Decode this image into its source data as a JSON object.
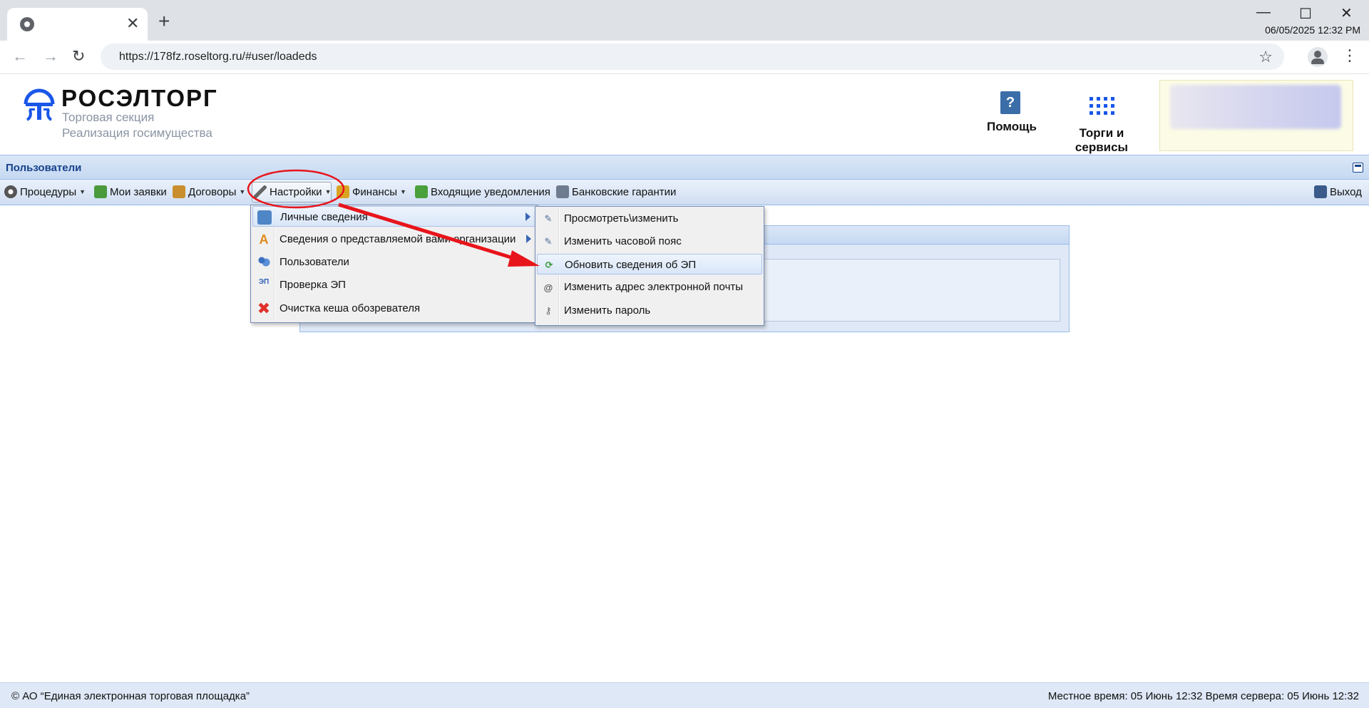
{
  "browser": {
    "url": "https://178fz.roseltorg.ru/#user/loadeds",
    "datetime": "06/05/2025 12:32 PM"
  },
  "header": {
    "logo_title": "РОСЭЛТОРГ",
    "logo_sub1": "Торговая секция",
    "logo_sub2": "Реализация госимущества",
    "help_label": "Помощь",
    "help_glyph": "?",
    "services_label": "Торги и сервисы"
  },
  "panel": {
    "title": "Пользователи"
  },
  "menubar": {
    "procedures": "Процедуры",
    "my_bids": "Мои заявки",
    "contracts": "Договоры",
    "settings": "Настройки",
    "finance": "Финансы",
    "notifications": "Входящие уведомления",
    "guarantees": "Банковские гарантии",
    "exit": "Выход"
  },
  "settings_menu": {
    "items": [
      {
        "label": "Личные сведения",
        "icon": "id-card-icon",
        "submenu": true
      },
      {
        "label": "Сведения о представляемой вами организации",
        "icon": "letter-a-icon",
        "submenu": true
      },
      {
        "label": "Пользователи",
        "icon": "users-icon",
        "submenu": false
      },
      {
        "label": "Проверка ЭП",
        "icon": "signature-check-icon",
        "submenu": false,
        "icon_text": "ЭП"
      },
      {
        "label": "Очистка кеша обозревателя",
        "icon": "red-x-icon",
        "submenu": false
      }
    ]
  },
  "personal_submenu": {
    "items": [
      {
        "label": "Просмотреть\\изменить",
        "icon": "pen-edit-icon"
      },
      {
        "label": "Изменить часовой пояс",
        "icon": "pen-edit-icon"
      },
      {
        "label": "Обновить сведения об ЭП",
        "icon": "refresh-signature-icon",
        "highlighted": true
      },
      {
        "label": "Изменить адрес электронной почты",
        "icon": "email-at-icon"
      },
      {
        "label": "Изменить пароль",
        "icon": "key-icon"
      }
    ]
  },
  "colors": {
    "brand_blue": "#1a56e8",
    "panel_title": "#15428b",
    "annotation_red": "#e8141b"
  },
  "footer": {
    "copyright": "© АО “Единая электронная торговая площадка”",
    "time": "Местное время: 05 Июнь 12:32 Время сервера: 05 Июнь 12:32"
  }
}
